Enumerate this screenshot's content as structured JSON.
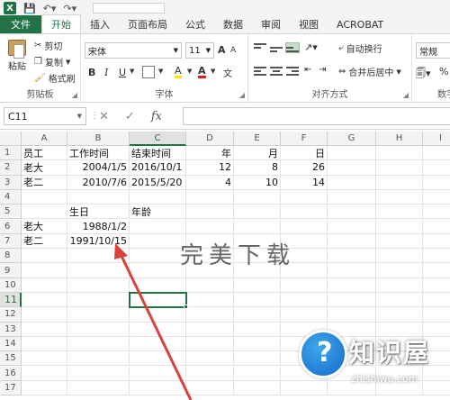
{
  "app": {
    "name": "Excel",
    "logo_letter": "X"
  },
  "tabs": [
    "文件",
    "开始",
    "插入",
    "页面布局",
    "公式",
    "数据",
    "审阅",
    "视图",
    "ACROBAT"
  ],
  "ribbon": {
    "clipboard": {
      "paste": "粘贴",
      "cut": "剪切",
      "copy": "复制",
      "format_painter": "格式刷",
      "label": "剪贴板"
    },
    "font": {
      "name": "宋体",
      "size": "11",
      "bold": "B",
      "italic": "I",
      "underline": "U",
      "label": "字体",
      "font_color_glyph": "A",
      "highlight_glyph": "A",
      "grow": "A",
      "shrink": "A",
      "phonetic": "文"
    },
    "alignment": {
      "wrap": "自动换行",
      "merge": "合并后居中",
      "label": "对齐方式"
    },
    "number": {
      "format": "常规",
      "label": "数字",
      "percent": "%"
    }
  },
  "formula_bar": {
    "name_box": "C11",
    "cancel": "✕",
    "enter": "✓",
    "fx": "fx",
    "value": ""
  },
  "columns": [
    "A",
    "B",
    "C",
    "D",
    "E",
    "F",
    "G",
    "H",
    "I"
  ],
  "rows": [
    "1",
    "2",
    "3",
    "4",
    "5",
    "6",
    "7",
    "8",
    "9",
    "10",
    "11",
    "12",
    "13",
    "14",
    "15",
    "16",
    "17"
  ],
  "cells": {
    "A1": "员工",
    "B1": "工作时间",
    "C1": "结束时间",
    "D1": "年",
    "E1": "月",
    "F1": "日",
    "A2": "老大",
    "B2": "2004/1/5",
    "C2": "2016/10/1",
    "D2": "12",
    "E2": "8",
    "F2": "26",
    "A3": "老二",
    "B3": "2010/7/6",
    "C3": "2015/5/20",
    "D3": "4",
    "E3": "10",
    "F3": "14",
    "B5": "生日",
    "C5": "年龄",
    "A6": "老大",
    "B6": "1988/1/2",
    "A7": "老二",
    "B7": "1991/10/15"
  },
  "watermark": "完美下载",
  "site_logo": {
    "text": "知识屋",
    "url": "zhishiwu.com",
    "color": "#1268c7"
  },
  "accent": "#217346"
}
